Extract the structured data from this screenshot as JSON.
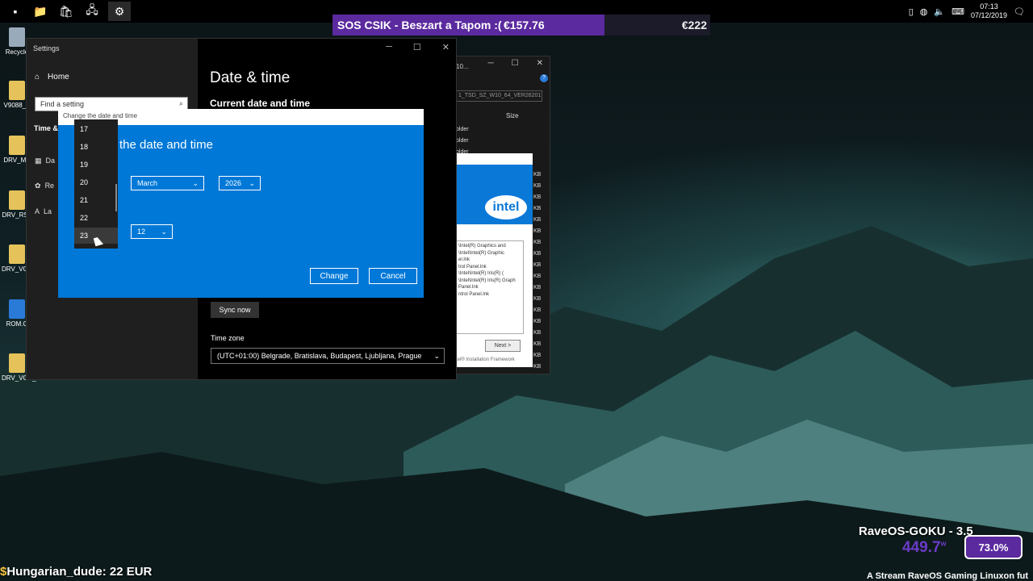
{
  "taskbar": {
    "icons": [
      "desktop-icon",
      "file-explorer-icon",
      "store-icon",
      "network-drive-icon",
      "settings-gear-icon"
    ],
    "tray_clock_time": "07:13",
    "tray_clock_date": "07/12/2019"
  },
  "banner": {
    "text": "SOS CSIK - Beszart a Tapom :(",
    "amount": "€157.76",
    "goal": "€222"
  },
  "desktop": {
    "icons": [
      "Recycle",
      "V9088_V",
      "DRV_ME",
      "DRV_RST",
      "DRV_VGA",
      "ROM.C",
      "DRV_VGA_L"
    ]
  },
  "settings": {
    "window_title": "Settings",
    "home": "Home",
    "search_placeholder": "Find a setting",
    "section": "Time &",
    "nav": [
      "Da",
      "Re",
      "La"
    ],
    "page_title": "Date & time",
    "subtitle": "Current date and time",
    "sync_label": "Sync now",
    "timezone_label": "Time zone",
    "timezone_value": "(UTC+01:00) Belgrade, Bratislava, Budapest, Ljubljana, Prague"
  },
  "dialog": {
    "title": "Change the date and time",
    "heading": "the date and time",
    "month": "March",
    "year": "2026",
    "hour": "12",
    "change": "Change",
    "cancel": "Cancel",
    "day_options": [
      "17",
      "18",
      "19",
      "20",
      "21",
      "22",
      "23"
    ],
    "selected_day": "23"
  },
  "explorer": {
    "title": "10...",
    "path": "1_TSD_SZ_W10_64_VER26201",
    "size_header": "Size",
    "folders": [
      "older",
      "older",
      "older"
    ],
    "kb": [
      "KB",
      "KB",
      "KB",
      "KB",
      "KB",
      "KB",
      "KB",
      "KB",
      "KB",
      "KB",
      "KB",
      "KB",
      "KB",
      "KB",
      "KB",
      "KB",
      "KB",
      "KB"
    ]
  },
  "installer": {
    "logo": "intel",
    "list": [
      "\\Intel(R) Graphics and",
      "\\Intel\\Intel(R) Graphic",
      "el.lnk",
      "trol Panel.lnk",
      "\\Intel\\Intel(R) Iris(R) (",
      "\\Intel\\Intel(R) Iris(R) Graph",
      "Panel.lnk",
      "ntrol Panel.lnk"
    ],
    "next": "Next >",
    "footer": "tel® Installation Framework"
  },
  "overlays": {
    "donor": "Hungarian_dude: 22 EUR",
    "raveos_title": "RaveOS-GOKU - 3.5",
    "raveos_value": "449.7",
    "raveos_unit": "w",
    "raveos_pct": "73.0%",
    "ticker": "A Stream RaveOS Gaming Linuxon fut"
  }
}
